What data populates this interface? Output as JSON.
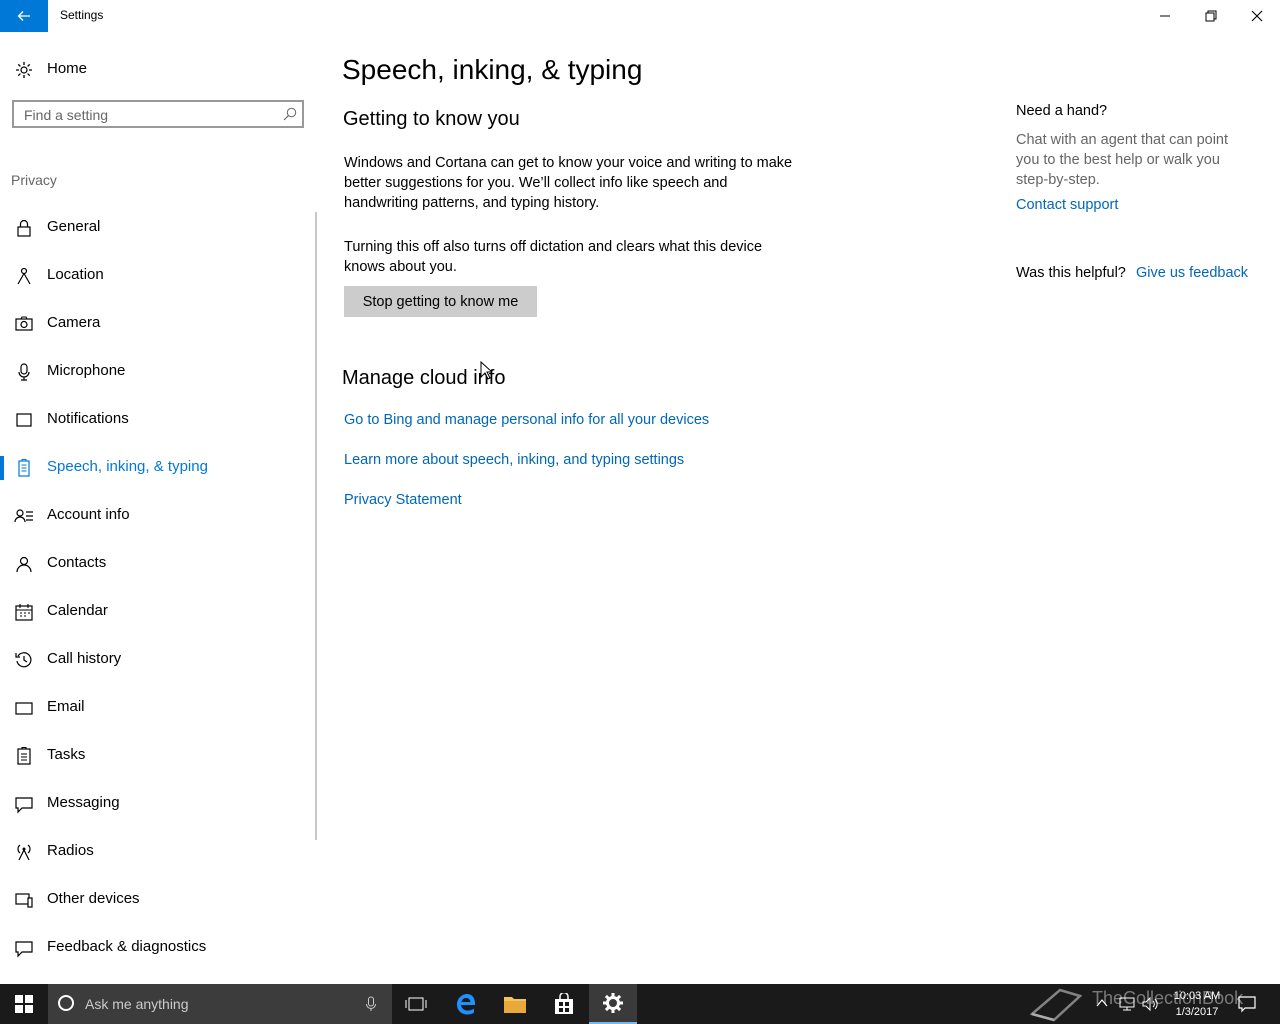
{
  "window": {
    "title": "Settings"
  },
  "sidebar": {
    "home_label": "Home",
    "search_placeholder": "Find a setting",
    "group_label": "Privacy",
    "items": [
      {
        "label": "General"
      },
      {
        "label": "Location"
      },
      {
        "label": "Camera"
      },
      {
        "label": "Microphone"
      },
      {
        "label": "Notifications"
      },
      {
        "label": "Speech, inking, & typing",
        "active": true
      },
      {
        "label": "Account info"
      },
      {
        "label": "Contacts"
      },
      {
        "label": "Calendar"
      },
      {
        "label": "Call history"
      },
      {
        "label": "Email"
      },
      {
        "label": "Tasks"
      },
      {
        "label": "Messaging"
      },
      {
        "label": "Radios"
      },
      {
        "label": "Other devices"
      },
      {
        "label": "Feedback & diagnostics"
      }
    ]
  },
  "main": {
    "title": "Speech, inking, & typing",
    "section1": {
      "heading": "Getting to know you",
      "para1": "Windows and Cortana can get to know your voice and writing to make better suggestions for you. We’ll collect info like speech and handwriting patterns, and typing history.",
      "para2": "Turning this off also turns off dictation and clears what this device knows about you.",
      "button": "Stop getting to know me"
    },
    "section2": {
      "heading": "Manage cloud info",
      "links": [
        "Go to Bing and manage personal info for all your devices",
        "Learn more about speech, inking, and typing settings",
        "Privacy Statement"
      ]
    }
  },
  "help": {
    "title": "Need a hand?",
    "text": "Chat with an agent that can point you to the best help or walk you step-by-step.",
    "contact_link": "Contact support",
    "helpful_label": "Was this helpful?",
    "feedback_link": "Give us feedback"
  },
  "taskbar": {
    "search_placeholder": "Ask me anything",
    "time": "10:03 AM",
    "date": "1/3/2017",
    "watermark": "TheCollectionBook"
  },
  "colors": {
    "accent": "#0078d7",
    "link": "#0067b8",
    "taskbar": "#1a1a1a"
  },
  "icons": {
    "back": "back-arrow-icon",
    "home": "gear-icon",
    "search": "search-icon",
    "items": [
      "lock-icon",
      "location-icon",
      "camera-icon",
      "microphone-icon",
      "notifications-icon",
      "speech-icon",
      "account-info-icon",
      "contacts-icon",
      "calendar-icon",
      "call-history-icon",
      "email-icon",
      "tasks-icon",
      "messaging-icon",
      "radios-icon",
      "other-devices-icon",
      "feedback-icon"
    ]
  }
}
